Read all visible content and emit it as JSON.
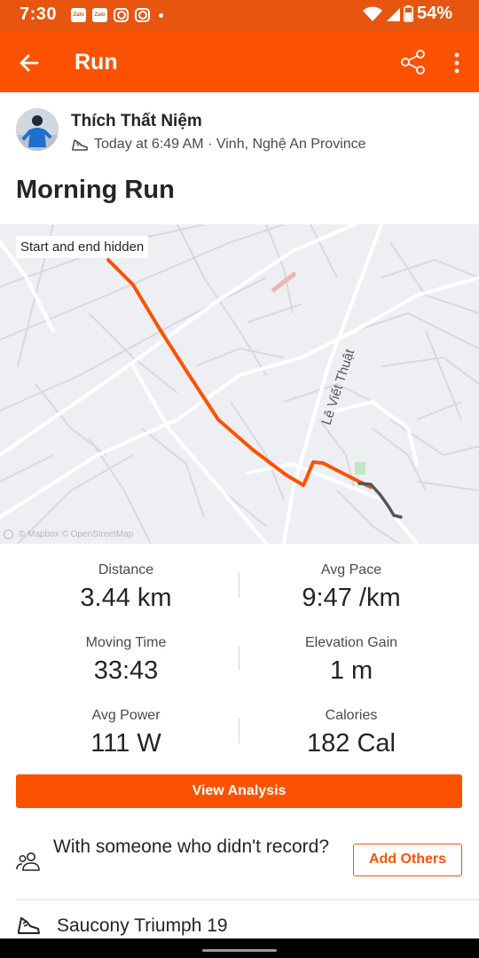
{
  "status_bar": {
    "time": "7:30",
    "notification_icons": [
      "zalo-icon",
      "zalo-icon",
      "instagram-icon",
      "instagram-icon",
      "dot-icon"
    ],
    "zalo_label": "Zalo",
    "battery": "54%"
  },
  "app_bar": {
    "title": "Run",
    "back_icon": "arrow-left-icon",
    "share_icon": "share-icon",
    "more_icon": "more-vertical-icon",
    "color": "#fc5200"
  },
  "athlete": {
    "name": "Thích Thất Niệm",
    "meta": "Today at 6:49 AM · Vinh, Nghệ An Province"
  },
  "activity": {
    "title": "Morning Run"
  },
  "map": {
    "badge": "Start and end hidden",
    "street_label": "Lê Viết Thuật",
    "attribution": "© Mapbox © OpenStreetMap",
    "route_color": "#fc5200",
    "hidden_route_color": "#555558"
  },
  "stats": [
    {
      "label": "Distance",
      "value": "3.44 km"
    },
    {
      "label": "Avg Pace",
      "value": "9:47 /km"
    },
    {
      "label": "Moving Time",
      "value": "33:43"
    },
    {
      "label": "Elevation Gain",
      "value": "1 m"
    },
    {
      "label": "Avg Power",
      "value": "111 W"
    },
    {
      "label": "Calories",
      "value": "182 Cal"
    }
  ],
  "actions": {
    "view_analysis": "View Analysis",
    "with_someone": "With someone who didn't record?",
    "add_others": "Add Others"
  },
  "gear": {
    "name": "Saucony Triumph 19"
  }
}
